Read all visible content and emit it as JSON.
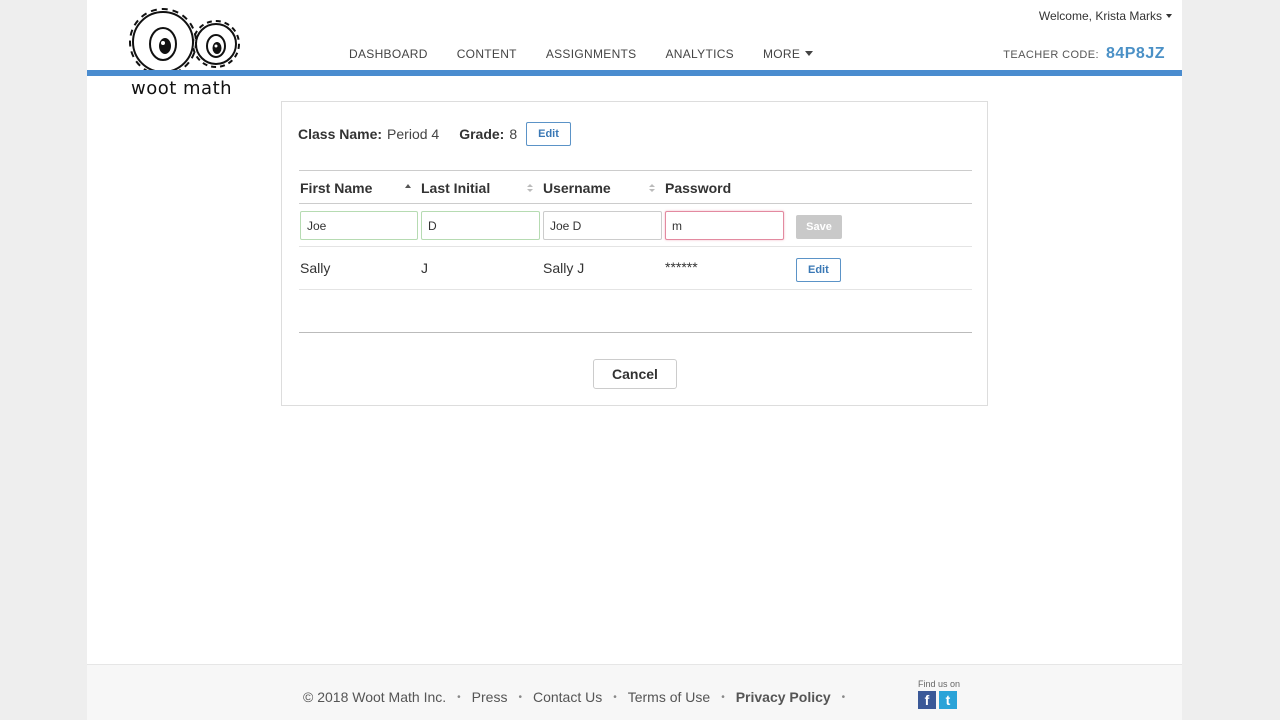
{
  "header": {
    "logo_text": "woot math",
    "nav": [
      {
        "label": "DASHBOARD"
      },
      {
        "label": "CONTENT"
      },
      {
        "label": "ASSIGNMENTS"
      },
      {
        "label": "ANALYTICS"
      },
      {
        "label": "MORE"
      }
    ],
    "welcome": "Welcome, Krista Marks",
    "teacher_code_label": "TEACHER CODE:",
    "teacher_code": "84P8JZ",
    "accent_color": "#4a8ccf"
  },
  "class_info": {
    "class_name_label": "Class Name:",
    "class_name": "Period 4",
    "grade_label": "Grade:",
    "grade": "8",
    "edit_label": "Edit"
  },
  "table": {
    "columns": [
      "First Name",
      "Last Initial",
      "Username",
      "Password"
    ],
    "editing_row": {
      "first_name": "Joe",
      "last_initial": "D",
      "username": "Joe D",
      "password": "m",
      "save_label": "Save"
    },
    "rows": [
      {
        "first_name": "Sally",
        "last_initial": "J",
        "username": "Sally J",
        "password": "******",
        "edit_label": "Edit"
      }
    ]
  },
  "cancel_label": "Cancel",
  "footer": {
    "copyright": "© 2018 Woot Math Inc.",
    "links": [
      "Press",
      "Contact Us",
      "Terms of Use",
      "Privacy Policy"
    ],
    "separator": "•",
    "find_us": "Find us on",
    "facebook_glyph": "f",
    "twitter_glyph": "t"
  }
}
